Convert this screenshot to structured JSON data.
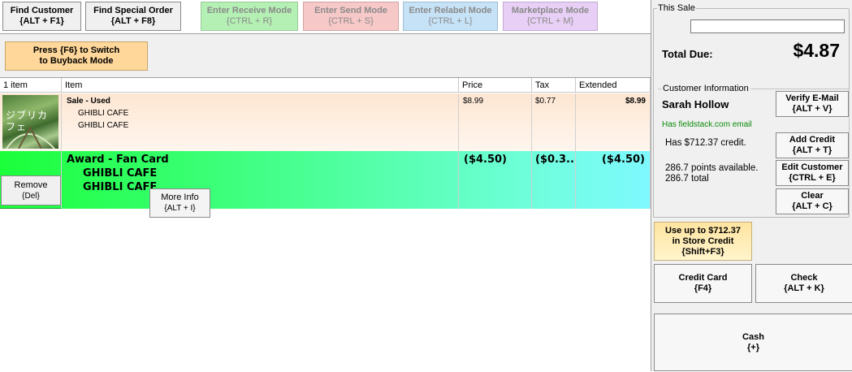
{
  "toolbar": {
    "find_customer": {
      "label": "Find Customer",
      "key": "{ALT + F1}"
    },
    "find_special_order": {
      "label": "Find Special Order",
      "key": "{ALT + F8}"
    },
    "receive_mode": {
      "label": "Enter Receive Mode",
      "key": "{CTRL + R}"
    },
    "send_mode": {
      "label": "Enter Send Mode",
      "key": "{CTRL + S}"
    },
    "relabel_mode": {
      "label": "Enter Relabel Mode",
      "key": "{CTRL + L}"
    },
    "marketplace_mode": {
      "label": "Marketplace Mode",
      "key": "{CTRL + M}"
    }
  },
  "buyback": {
    "line1": "Press {F6} to Switch",
    "line2": "to Buyback Mode"
  },
  "grid": {
    "headers": {
      "count": "1 item",
      "item": "Item",
      "price": "Price",
      "tax": "Tax",
      "extended": "Extended"
    },
    "rows": [
      {
        "title": "Sale - Used",
        "line1": "GHIBLI CAFE",
        "line2": "GHIBLI CAFE",
        "price": "$8.99",
        "tax": "$0.77",
        "extended": "$8.99",
        "thumb_text": "ジブリカフェ"
      },
      {
        "title": "Award - Fan Card",
        "line1": "GHIBLI CAFE",
        "line2": "GHIBLI CAFE",
        "price": "($4.50)",
        "tax": "($0.3...",
        "extended": "($4.50)"
      }
    ],
    "remove": {
      "label": "Remove",
      "key": "{Del}"
    },
    "more_info": {
      "label": "More Info",
      "key": "{ALT + I}"
    }
  },
  "sale": {
    "legend": "This Sale",
    "input_value": "",
    "total_label": "Total Due:",
    "total_value": "$4.87"
  },
  "customer": {
    "legend": "Customer Information",
    "name": "Sarah Hollow",
    "email_status": "Has fieldstack.com email",
    "credit": "Has $712.37 credit.",
    "points_available": "286.7 points available.",
    "points_total": "286.7 total",
    "verify_email": {
      "label": "Verify E-Mail",
      "key": "{ALT + V}"
    },
    "add_credit": {
      "label": "Add Credit",
      "key": "{ALT + T}"
    },
    "edit_customer": {
      "label": "Edit Customer",
      "key": "{CTRL + E}"
    },
    "clear": {
      "label": "Clear",
      "key": "{ALT + C}"
    }
  },
  "payment": {
    "store_credit": {
      "line1": "Use up to $712.37",
      "line2": "in Store Credit",
      "key": "{Shift+F3}"
    },
    "credit_card": {
      "label": "Credit Card",
      "key": "{F4}"
    },
    "check": {
      "label": "Check",
      "key": "{ALT + K}"
    },
    "cash": {
      "label": "Cash",
      "key": "{+}"
    }
  },
  "colors": {
    "email_status": "#0a8a0a",
    "store_credit_bg": "#ffe9b0",
    "buyback_bg": "#ffd79a"
  }
}
